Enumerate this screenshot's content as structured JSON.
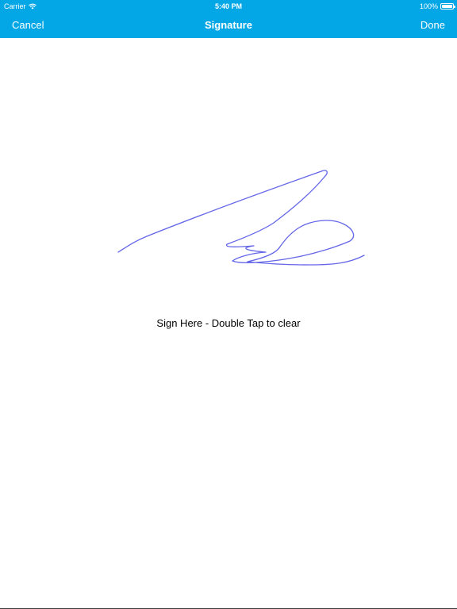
{
  "status_bar": {
    "carrier": "Carrier",
    "time": "5:40 PM",
    "battery": "100%",
    "wifi_icon": "wifi-icon",
    "battery_icon": "battery-icon"
  },
  "nav": {
    "cancel": "Cancel",
    "title": "Signature",
    "done": "Done"
  },
  "signature_pad": {
    "hint": "Sign Here - Double Tap to clear",
    "stroke_color": "#6466e8"
  },
  "colors": {
    "bar": "#04a7e6",
    "text_on_bar": "#ffffff",
    "background": "#ffffff"
  }
}
